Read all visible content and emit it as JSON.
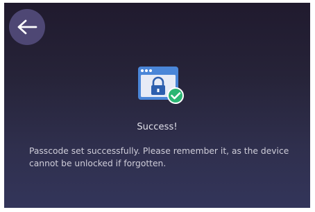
{
  "back_button": {
    "icon": "arrow-left-icon"
  },
  "status": {
    "icon": "unlocked-window-check-icon",
    "title": "Success!",
    "message": "Passcode set successfully. Please remember it, as the device cannot be unlocked if forgotten."
  },
  "colors": {
    "accent_check": "#2bb673",
    "window_blue": "#4a86d8",
    "button_bg": "#4e4774"
  }
}
